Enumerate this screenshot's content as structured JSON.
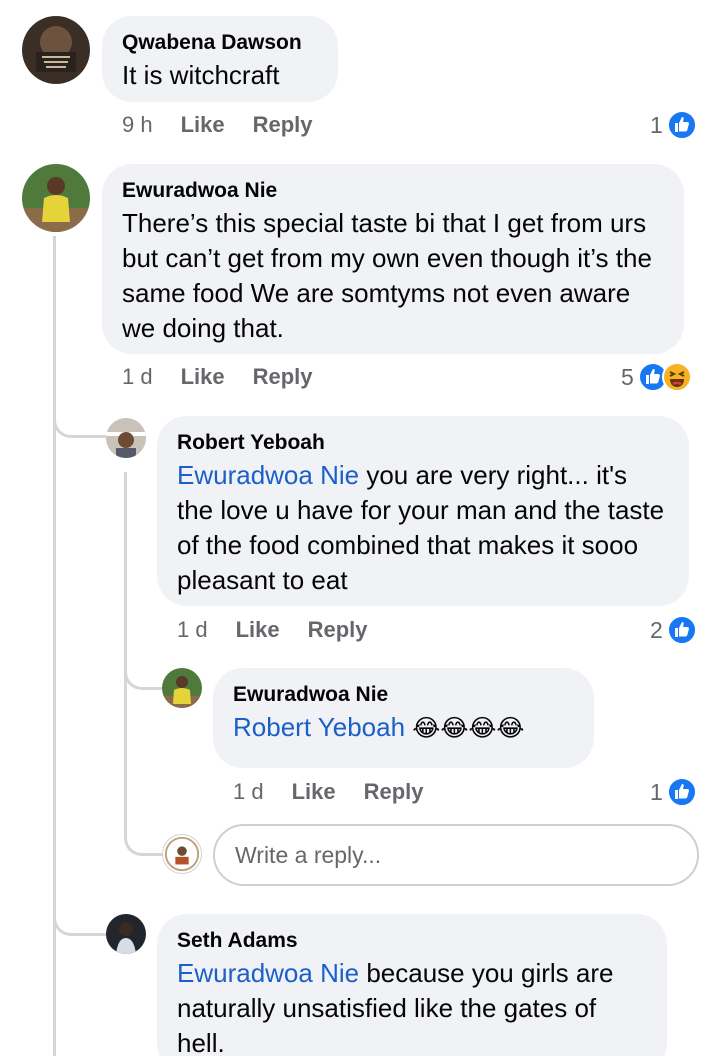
{
  "comments": [
    {
      "author": "Qwabena Dawson",
      "text": "It is witchcraft",
      "time": "9 h",
      "like_label": "Like",
      "reply_label": "Reply",
      "reaction_count": "1"
    },
    {
      "author": "Ewuradwoa Nie",
      "text": "There’s this special taste bi that I get from urs but can’t get from my own even though it’s the same food We are somtyms not even aware we doing that.",
      "time": "1 d",
      "like_label": "Like",
      "reply_label": "Reply",
      "reaction_count": "5"
    },
    {
      "author": "Robert Yeboah",
      "mention": "Ewuradwoa Nie",
      "text": " you are very right... it's the love u have for your man and the taste of the food combined that makes it sooo pleasant to eat",
      "time": "1 d",
      "like_label": "Like",
      "reply_label": "Reply",
      "reaction_count": "2"
    },
    {
      "author": "Ewuradwoa Nie",
      "mention": "Robert Yeboah",
      "emoji": "😂😂😂😂",
      "time": "1 d",
      "like_label": "Like",
      "reply_label": "Reply",
      "reaction_count": "1"
    },
    {
      "author": "Seth Adams",
      "mention": "Ewuradwoa Nie",
      "text": " because you girls are naturally unsatisfied like the gates of hell."
    }
  ],
  "reply_box": {
    "placeholder": "Write a reply..."
  },
  "colors": {
    "bubble": "#f0f2f5",
    "mention": "#1b5fc9",
    "like_blue": "#1877f2",
    "meta_gray": "#65676b",
    "thread_line": "#d4d6da",
    "haha_yellow": "#f7b125"
  }
}
